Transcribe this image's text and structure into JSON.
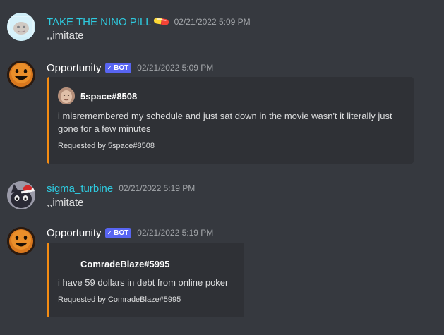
{
  "messages": [
    {
      "username": "TAKE THE NINO PILL",
      "username_color": "#2ecbe0",
      "emoji": "💊",
      "timestamp": "02/21/2022 5:09 PM",
      "content": ",,imitate"
    },
    {
      "username": "Opportunity",
      "username_color": "#ffffff",
      "bot_tag": "BOT",
      "timestamp": "02/21/2022 5:09 PM",
      "embed": {
        "author": "5space#8508",
        "description": "i misremembered my schedule and just sat down in the movie wasn't it literally just gone for a few minutes",
        "footer": "Requested by 5space#8508",
        "color": "#f48c13"
      }
    },
    {
      "username": "sigma_turbine",
      "username_color": "#2ecbe0",
      "timestamp": "02/21/2022 5:19 PM",
      "content": ",,imitate"
    },
    {
      "username": "Opportunity",
      "username_color": "#ffffff",
      "bot_tag": "BOT",
      "timestamp": "02/21/2022 5:19 PM",
      "embed": {
        "author": "ComradeBlaze#5995",
        "description": "i have 59 dollars in debt from online poker",
        "footer": "Requested by ComradeBlaze#5995",
        "color": "#f48c13"
      }
    }
  ]
}
